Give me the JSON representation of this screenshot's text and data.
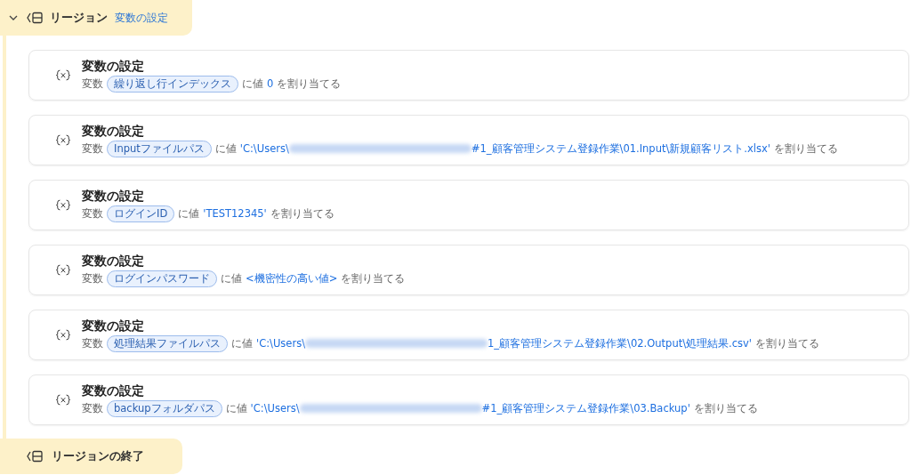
{
  "region_header": {
    "expanded": true,
    "label": "リージョン",
    "name": "変数の設定"
  },
  "actions": [
    {
      "title": "変数の設定",
      "prefix": "変数",
      "variable": "繰り返し行インデックス",
      "middle": "に値",
      "value": [
        {
          "kind": "text",
          "text": "0"
        }
      ],
      "suffix": "を割り当てる"
    },
    {
      "title": "変数の設定",
      "prefix": "変数",
      "variable": "Inputファイルパス",
      "middle": "に値",
      "value": [
        {
          "kind": "text",
          "text": "'C:\\Users\\"
        },
        {
          "kind": "redacted"
        },
        {
          "kind": "text",
          "text": "#1_顧客管理システム登録作業\\01.Input\\新規顧客リスト.xlsx'"
        }
      ],
      "suffix": "を割り当てる"
    },
    {
      "title": "変数の設定",
      "prefix": "変数",
      "variable": "ログインID",
      "middle": "に値",
      "value": [
        {
          "kind": "text",
          "text": "'TEST12345'"
        }
      ],
      "suffix": "を割り当てる"
    },
    {
      "title": "変数の設定",
      "prefix": "変数",
      "variable": "ログインパスワード",
      "middle": "に値",
      "value": [
        {
          "kind": "text",
          "text": "<機密性の高い値>"
        }
      ],
      "suffix": "を割り当てる"
    },
    {
      "title": "変数の設定",
      "prefix": "変数",
      "variable": "処理結果ファイルパス",
      "middle": "に値",
      "value": [
        {
          "kind": "text",
          "text": "'C:\\Users\\"
        },
        {
          "kind": "redacted"
        },
        {
          "kind": "text",
          "text": "1_顧客管理システム登録作業\\02.Output\\処理結果.csv'"
        }
      ],
      "suffix": "を割り当てる"
    },
    {
      "title": "変数の設定",
      "prefix": "変数",
      "variable": "backupフォルダパス",
      "middle": "に値",
      "value": [
        {
          "kind": "text",
          "text": "'C:\\Users\\"
        },
        {
          "kind": "redacted"
        },
        {
          "kind": "text",
          "text": "#1_顧客管理システム登録作業\\03.Backup'"
        }
      ],
      "suffix": "を割り当てる"
    }
  ],
  "region_end": {
    "label": "リージョンの終了"
  }
}
